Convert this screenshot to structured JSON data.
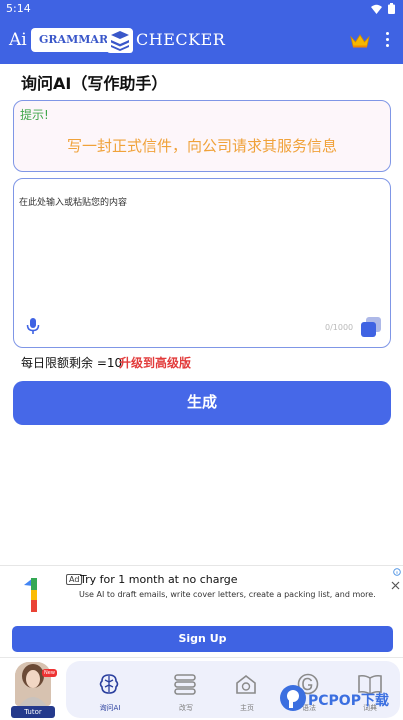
{
  "status_bar": {
    "time": "5:14"
  },
  "app_bar": {
    "ai_label": "Ai",
    "brand_left": "GRAMMAR",
    "brand_right": "CHECKER",
    "icons": [
      "book-icon",
      "crown-icon",
      "more-vert-icon"
    ]
  },
  "page": {
    "title": "询问AI（写作助手）"
  },
  "hint": {
    "label": "提示!",
    "text": "写一封正式信件，向公司请求其服务信息"
  },
  "input": {
    "placeholder": "在此处输入或粘贴您的内容",
    "counter": "0/1000"
  },
  "quota": {
    "text": "每日限额剩余 =10",
    "upgrade": "升级到高级版"
  },
  "generate_button": "生成",
  "ad": {
    "badge": "Ad",
    "headline": "Try for 1 month at no charge",
    "description": "Use AI to draft emails, write cover letters, create a packing list, and more.",
    "cta": "Sign Up"
  },
  "bottom_nav": {
    "tutor_label": "Tutor",
    "new_badge": "New",
    "items": [
      {
        "label": "询问AI",
        "active": true
      },
      {
        "label": "改写",
        "active": false
      },
      {
        "label": "主页",
        "active": false
      },
      {
        "label": "语法",
        "active": false
      },
      {
        "label": "词典",
        "active": false
      }
    ]
  },
  "watermark": {
    "text": "PCPOP下载"
  },
  "colors": {
    "primary": "#3f63e3",
    "button": "#4668e8",
    "hint_text": "#f0a23a",
    "hint_label": "#3fa64a",
    "upgrade": "#e23b3b"
  }
}
